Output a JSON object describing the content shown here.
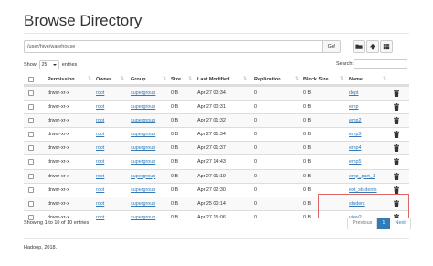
{
  "page": {
    "title": "Browse Directory",
    "path_value": "/user/hive/warehouse",
    "go_label": "Go!",
    "show_label": "Show",
    "entries_select_value": "25",
    "entries_label": "entries",
    "search_label": "Search:",
    "search_value": ""
  },
  "table": {
    "headers": {
      "permission": "Permission",
      "owner": "Owner",
      "group": "Group",
      "size": "Size",
      "last_modified": "Last Modified",
      "replication": "Replication",
      "block_size": "Block Size",
      "name": "Name"
    },
    "rows": [
      {
        "permission": "drwxr-xr-x",
        "owner": "root",
        "group": "supergroup",
        "size": "0 B",
        "last_modified": "Apr 27 00:34",
        "replication": "0",
        "block_size": "0 B",
        "name": "dept"
      },
      {
        "permission": "drwxr-xr-x",
        "owner": "root",
        "group": "supergroup",
        "size": "0 B",
        "last_modified": "Apr 27 00:31",
        "replication": "0",
        "block_size": "0 B",
        "name": "emp"
      },
      {
        "permission": "drwxr-xr-x",
        "owner": "root",
        "group": "supergroup",
        "size": "0 B",
        "last_modified": "Apr 27 01:32",
        "replication": "0",
        "block_size": "0 B",
        "name": "emp2"
      },
      {
        "permission": "drwxr-xr-x",
        "owner": "root",
        "group": "supergroup",
        "size": "0 B",
        "last_modified": "Apr 27 01:34",
        "replication": "0",
        "block_size": "0 B",
        "name": "emp3"
      },
      {
        "permission": "drwxr-xr-x",
        "owner": "root",
        "group": "supergroup",
        "size": "0 B",
        "last_modified": "Apr 27 01:37",
        "replication": "0",
        "block_size": "0 B",
        "name": "emp4"
      },
      {
        "permission": "drwxr-xr-x",
        "owner": "root",
        "group": "supergroup",
        "size": "0 B",
        "last_modified": "Apr 27 14:43",
        "replication": "0",
        "block_size": "0 B",
        "name": "emp5"
      },
      {
        "permission": "drwxr-xr-x",
        "owner": "root",
        "group": "supergroup",
        "size": "0 B",
        "last_modified": "Apr 27 01:19",
        "replication": "0",
        "block_size": "0 B",
        "name": "emp_part_1"
      },
      {
        "permission": "drwxr-xr-x",
        "owner": "root",
        "group": "supergroup",
        "size": "0 B",
        "last_modified": "Apr 27 02:30",
        "replication": "0",
        "block_size": "0 B",
        "name": "ext_students"
      },
      {
        "permission": "drwxr-xr-x",
        "owner": "root",
        "group": "supergroup",
        "size": "0 B",
        "last_modified": "Apr 25 00:14",
        "replication": "0",
        "block_size": "0 B",
        "name": "student"
      },
      {
        "permission": "drwxr-xr-x",
        "owner": "root",
        "group": "supergroup",
        "size": "0 B",
        "last_modified": "Apr 27 15:06",
        "replication": "0",
        "block_size": "0 B",
        "name": "view2"
      }
    ]
  },
  "footer_info": "Showing 1 to 10 of 10 entries",
  "pagination": {
    "previous": "Previous",
    "current": "1",
    "next": "Next"
  },
  "footer_text": "Hadoop, 2018.",
  "icons": {
    "folder": "folder-icon",
    "upload": "upload-icon",
    "list": "list-icon",
    "trash": "trash-icon",
    "sort": "sort-icon"
  },
  "colors": {
    "link": "#337ab7",
    "highlight_border": "#e06666"
  }
}
